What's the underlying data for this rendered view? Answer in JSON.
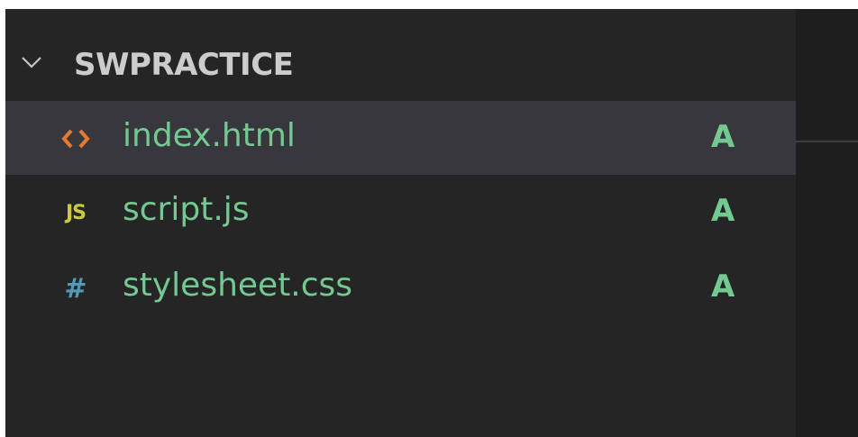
{
  "explorer": {
    "section_title": "SWPRACTICE",
    "files": [
      {
        "name": "index.html",
        "status": "A",
        "icon": "html-file-icon",
        "selected": true
      },
      {
        "name": "script.js",
        "status": "A",
        "icon": "js-file-icon",
        "selected": false
      },
      {
        "name": "stylesheet.css",
        "status": "A",
        "icon": "css-file-icon",
        "selected": false
      }
    ]
  },
  "colors": {
    "sidebar_bg": "#252526",
    "selected_bg": "#37373d",
    "added_green": "#73c991",
    "html_orange": "#e37933",
    "js_yellow": "#cbcb41",
    "css_blue": "#519aba"
  }
}
